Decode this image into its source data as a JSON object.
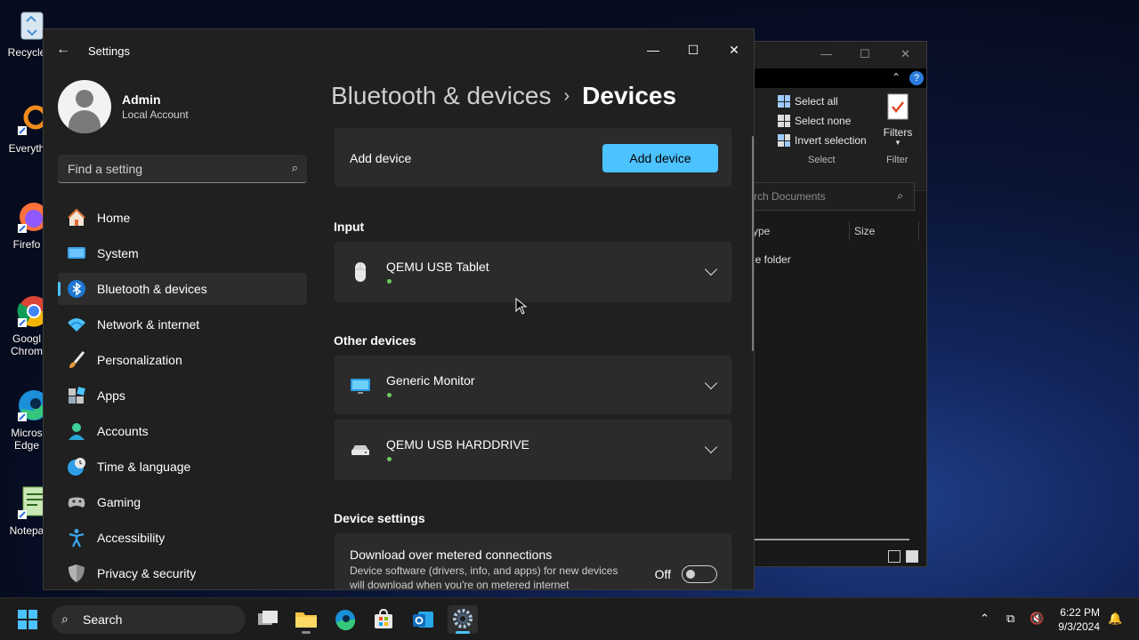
{
  "desktop": {
    "icons": [
      {
        "label": "Recycle",
        "icon": "recycle-bin-icon"
      },
      {
        "label": "Everyth",
        "icon": "everything-search-icon"
      },
      {
        "label": "Firefo",
        "icon": "firefox-icon"
      },
      {
        "label": "Googl",
        "label2": "Chrom",
        "icon": "chrome-icon"
      },
      {
        "label": "Micros",
        "label2": "Edge",
        "icon": "edge-icon"
      },
      {
        "label": "Notepa",
        "icon": "notepad-icon"
      }
    ]
  },
  "explorer": {
    "ribbon": {
      "select_all": "Select all",
      "select_none": "Select none",
      "invert_selection": "Invert selection",
      "select_group": "Select",
      "filters": "Filters",
      "filter_group": "Filter"
    },
    "search_placeholder": "rch Documents",
    "columns": {
      "type": "ype",
      "size": "Size"
    },
    "row_type": "le folder"
  },
  "settings": {
    "app_title": "Settings",
    "user": {
      "name": "Admin",
      "account_type": "Local Account"
    },
    "search_placeholder": "Find a setting",
    "nav": [
      {
        "label": "Home",
        "icon": "home-icon"
      },
      {
        "label": "System",
        "icon": "system-icon"
      },
      {
        "label": "Bluetooth & devices",
        "icon": "bluetooth-icon",
        "selected": true
      },
      {
        "label": "Network & internet",
        "icon": "wifi-icon"
      },
      {
        "label": "Personalization",
        "icon": "brush-icon"
      },
      {
        "label": "Apps",
        "icon": "apps-icon"
      },
      {
        "label": "Accounts",
        "icon": "accounts-icon"
      },
      {
        "label": "Time & language",
        "icon": "globe-clock-icon"
      },
      {
        "label": "Gaming",
        "icon": "gamepad-icon"
      },
      {
        "label": "Accessibility",
        "icon": "accessibility-icon"
      },
      {
        "label": "Privacy & security",
        "icon": "shield-icon"
      }
    ],
    "breadcrumb": {
      "parent": "Bluetooth & devices",
      "separator": "›",
      "current": "Devices"
    },
    "add_device": {
      "label": "Add device",
      "button": "Add device"
    },
    "sections": {
      "input": "Input",
      "other": "Other devices",
      "device_settings": "Device settings"
    },
    "input_devices": [
      {
        "name": "QEMU USB Tablet",
        "icon": "mouse-icon"
      }
    ],
    "other_devices": [
      {
        "name": "Generic Monitor",
        "icon": "monitor-icon"
      },
      {
        "name": "QEMU USB HARDDRIVE",
        "icon": "drive-icon"
      }
    ],
    "metered": {
      "title": "Download over metered connections",
      "description_line1": "Device software (drivers, info, and apps) for new devices",
      "description_line2": "will download when you're on metered internet",
      "state": "Off"
    }
  },
  "taskbar": {
    "search_placeholder": "Search",
    "time": "6:22 PM",
    "date": "9/3/2024",
    "accent": "#4cc2ff"
  }
}
